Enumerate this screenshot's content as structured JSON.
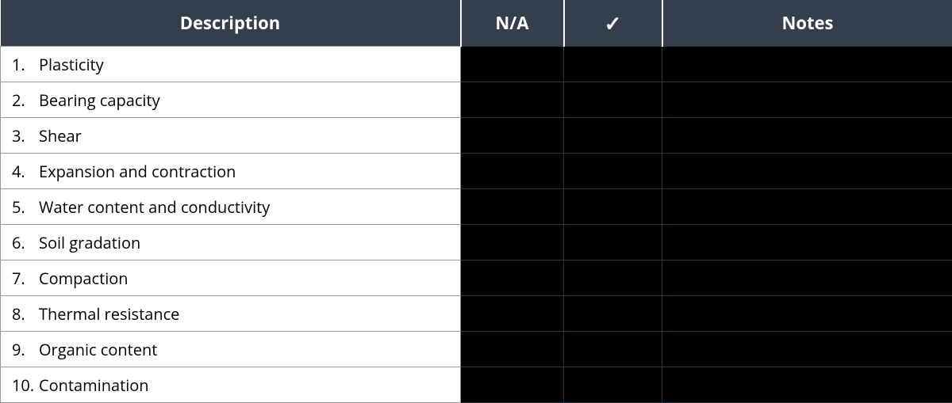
{
  "table": {
    "headers": {
      "description": "Description",
      "na": "N/A",
      "check": "✓",
      "notes": "Notes"
    },
    "rows": [
      {
        "num": "1.",
        "label": "Plasticity"
      },
      {
        "num": "2.",
        "label": "Bearing capacity"
      },
      {
        "num": "3.",
        "label": "Shear"
      },
      {
        "num": "4.",
        "label": "Expansion and contraction"
      },
      {
        "num": "5.",
        "label": "Water content and conductivity"
      },
      {
        "num": "6.",
        "label": "Soil gradation"
      },
      {
        "num": "7.",
        "label": "Compaction"
      },
      {
        "num": "8.",
        "label": "Thermal resistance"
      },
      {
        "num": "9.",
        "label": "Organic content"
      },
      {
        "num": "10.",
        "label": "Contamination"
      }
    ]
  }
}
